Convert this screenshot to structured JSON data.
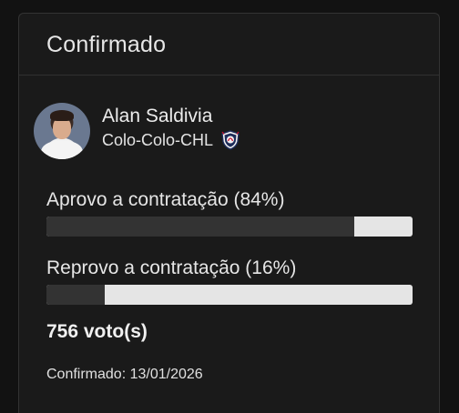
{
  "card": {
    "title": "Confirmado"
  },
  "player": {
    "name": "Alan Saldivia",
    "team": "Colo-Colo-CHL",
    "avatar_icon": "player-avatar-photo",
    "badge_icon": "colo-colo-crest-icon"
  },
  "poll": {
    "approve": {
      "label": "Aprovo a contratação (84%)",
      "percent": 84
    },
    "reject": {
      "label": "Reprovo a contratação (16%)",
      "percent": 16
    },
    "votes_text": "756 voto(s)"
  },
  "footer": {
    "confirmed_text": "Confirmado: 13/01/2026"
  },
  "colors": {
    "bar_fill": "#333333",
    "bar_track": "#e5e5e5",
    "background": "#121212"
  }
}
